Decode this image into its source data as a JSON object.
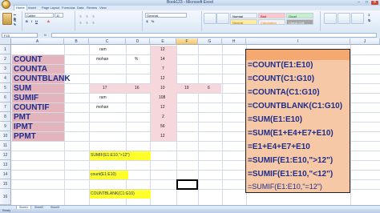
{
  "window": {
    "title": "Book123 - Microsoft Excel",
    "controls": [
      "–",
      "□",
      "✕"
    ]
  },
  "menu": {
    "tabs": [
      "Home",
      "Insert",
      "Page Layout",
      "Formulas",
      "Data",
      "Review",
      "View"
    ],
    "active": "Home"
  },
  "ribbon": {
    "font_name": "Calibri",
    "font_size": "11",
    "number_format": "General",
    "styles": [
      {
        "label": "Normal",
        "bg": "#ffffff",
        "fg": "#000000"
      },
      {
        "label": "Bad",
        "bg": "#ffc7ce",
        "fg": "#9c0006"
      },
      {
        "label": "Good",
        "bg": "#c6efce",
        "fg": "#006100"
      },
      {
        "label": "Neutral",
        "bg": "#ffeb9c",
        "fg": "#9c6500"
      },
      {
        "label": "Calculation",
        "bg": "#f2f2f2",
        "fg": "#fa7d00"
      },
      {
        "label": "Check Cell",
        "bg": "#a5a5a5",
        "fg": "#ffffff"
      }
    ],
    "big_buttons": [
      "Conditional Formatting",
      "Format as Table",
      "Insert",
      "Delete",
      "Format"
    ]
  },
  "formula_bar": {
    "name_box": "F15",
    "fx": "fx",
    "formula": ""
  },
  "columns": [
    "A",
    "B",
    "C",
    "D",
    "E",
    "F",
    "G",
    "H",
    "I",
    "J"
  ],
  "selected_column": "F",
  "rows": [
    "1",
    "2",
    "3",
    "4",
    "5",
    "6",
    "7",
    "8",
    "9",
    "10",
    "11",
    "12",
    "13",
    "14",
    "15",
    "16"
  ],
  "labels": [
    {
      "row": "2",
      "text": "COUNT"
    },
    {
      "row": "3",
      "text": "COUNTA"
    },
    {
      "row": "4",
      "text": "COUNTBLANK"
    },
    {
      "row": "5",
      "text": "SUM"
    },
    {
      "row": "6",
      "text": "SUMIF"
    },
    {
      "row": "7",
      "text": "COUNTIF"
    },
    {
      "row": "8",
      "text": "PMT"
    },
    {
      "row": "9",
      "text": "IPMT"
    },
    {
      "row": "10",
      "text": "PPMT"
    }
  ],
  "cells": {
    "C1": "ram",
    "C2": "mohan",
    "D2": "%",
    "E1": "12",
    "E2": "14",
    "E3": "7",
    "E4": "12",
    "C5": "17",
    "D5": "16",
    "E5": "10",
    "F5": "19",
    "G5": "6",
    "C6": "ram",
    "E6": "108",
    "C7": "mohan",
    "E7": "12",
    "E8": "2",
    "E9": "56",
    "E10": "12"
  },
  "notes": [
    {
      "id": "n12",
      "text": "SUMIF(E1:E10,\">12\")"
    },
    {
      "id": "n14",
      "text": "count(E1:E10)"
    },
    {
      "id": "n16",
      "text": "COUNTBLANK(C1:G10)"
    }
  ],
  "formula_box": {
    "lines": [
      "=COUNT(E1:E10)",
      "=COUNT(C1:G10)",
      "=COUNTA(C1:G10)",
      "=COUNTBLANK(C1:G10)",
      "=SUM(E1:E10)",
      "=SUM(E1+E4+E7+E10)",
      "=E1+E4+E7+E10",
      "=SUMIF(E1:E10,\">12\")",
      "=SUMIF(E1:E10,\"<12\")",
      "=SUMIF(E1:E10,\"=12\")"
    ]
  },
  "sheets": [
    "Sheet1",
    "Sheet2",
    "Sheet3"
  ],
  "status": "Ready"
}
